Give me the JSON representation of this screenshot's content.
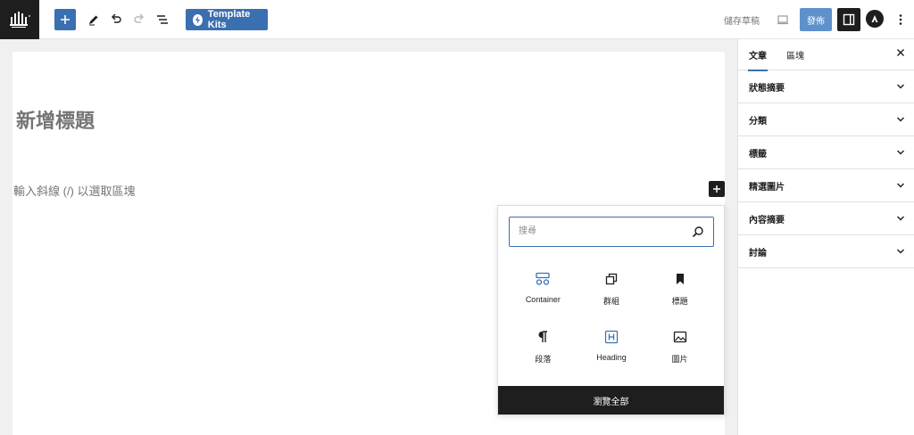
{
  "toolbar": {
    "template_kits_label": "Template Kits",
    "save_draft_label": "儲存草稿",
    "publish_label": "發佈"
  },
  "editor": {
    "title_placeholder": "新增標題",
    "block_placeholder": "輸入斜線 (/) 以選取區塊"
  },
  "inserter": {
    "search_placeholder": "搜尋",
    "blocks": [
      {
        "label": "Container",
        "icon": "container-icon"
      },
      {
        "label": "群組",
        "icon": "group-icon"
      },
      {
        "label": "標題",
        "icon": "bookmark-icon"
      },
      {
        "label": "段落",
        "icon": "paragraph-icon"
      },
      {
        "label": "Heading",
        "icon": "heading-icon"
      },
      {
        "label": "圖片",
        "icon": "image-icon"
      }
    ],
    "browse_all_label": "瀏覽全部"
  },
  "sidebar": {
    "tabs": [
      {
        "label": "文章",
        "active": true
      },
      {
        "label": "區塊",
        "active": false
      }
    ],
    "panels": [
      {
        "label": "狀態摘要"
      },
      {
        "label": "分類"
      },
      {
        "label": "標籤"
      },
      {
        "label": "精選圖片"
      },
      {
        "label": "內容摘要"
      },
      {
        "label": "討論"
      }
    ]
  },
  "colors": {
    "accent": "#3a6fb0",
    "publish": "#5e91cb",
    "dark": "#1e1e1e"
  }
}
